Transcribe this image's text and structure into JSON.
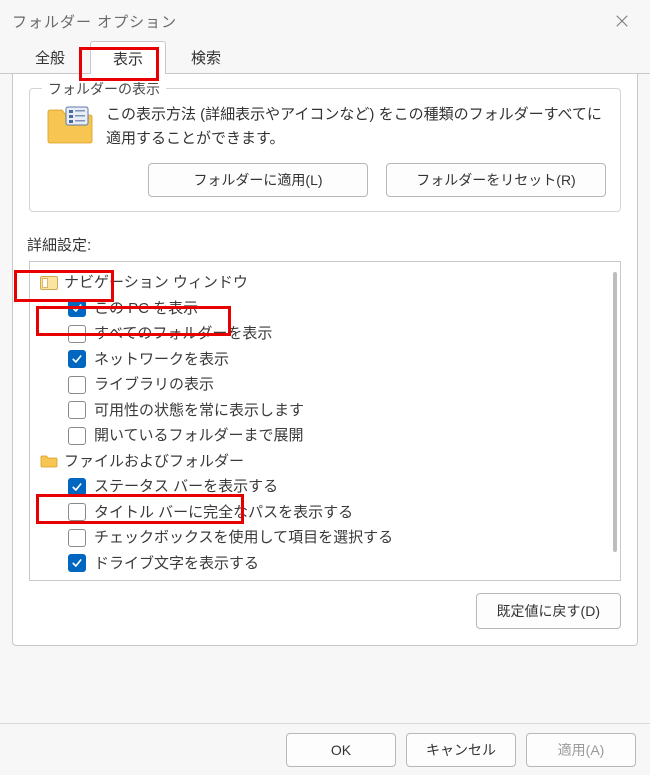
{
  "window": {
    "title": "フォルダー オプション"
  },
  "tabs": {
    "general": "全般",
    "view": "表示",
    "search": "検索"
  },
  "folder_view": {
    "group_label": "フォルダーの表示",
    "description": "この表示方法 (詳細表示やアイコンなど) をこの種類のフォルダーすべてに適用することができます。",
    "apply_label": "フォルダーに適用(L)",
    "reset_label": "フォルダーをリセット(R)"
  },
  "advanced": {
    "label": "詳細設定:"
  },
  "tree": {
    "groups": [
      {
        "icon": "nav-pane",
        "label": "ナビゲーション ウィンドウ",
        "items": [
          {
            "checked": true,
            "label": "この PC を表示"
          },
          {
            "checked": false,
            "label": "すべてのフォルダーを表示"
          },
          {
            "checked": true,
            "label": "ネットワークを表示"
          },
          {
            "checked": false,
            "label": "ライブラリの表示"
          },
          {
            "checked": false,
            "label": "可用性の状態を常に表示します"
          },
          {
            "checked": false,
            "label": "開いているフォルダーまで展開"
          }
        ]
      },
      {
        "icon": "folder",
        "label": "ファイルおよびフォルダー",
        "items": [
          {
            "checked": true,
            "label": "ステータス バーを表示する"
          },
          {
            "checked": false,
            "label": "タイトル バーに完全なパスを表示する"
          },
          {
            "checked": false,
            "label": "チェックボックスを使用して項目を選択する"
          },
          {
            "checked": true,
            "label": "ドライブ文字を表示する"
          }
        ]
      }
    ]
  },
  "buttons": {
    "restore_defaults": "既定値に戻す(D)",
    "ok": "OK",
    "cancel": "キャンセル",
    "apply": "適用(A)"
  }
}
